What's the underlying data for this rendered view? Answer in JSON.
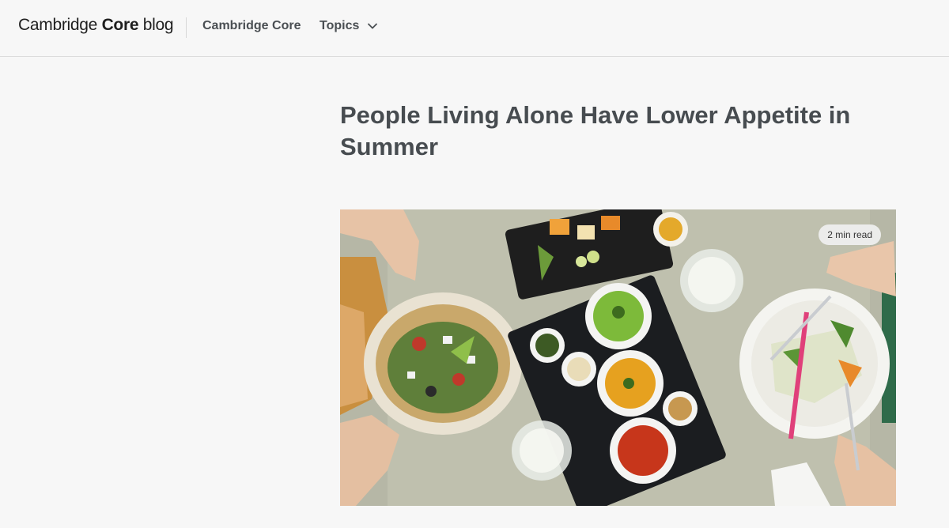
{
  "header": {
    "logo": {
      "brand": "Cambridge",
      "core": "Core",
      "suffix": "blog"
    },
    "nav": {
      "cambridge_core": "Cambridge Core",
      "topics": "Topics"
    }
  },
  "article": {
    "title": "People Living Alone Have Lower Appetite in Summer",
    "read_time": "2 min read"
  },
  "icons": {
    "topics_dropdown": "chevron-down-icon"
  }
}
